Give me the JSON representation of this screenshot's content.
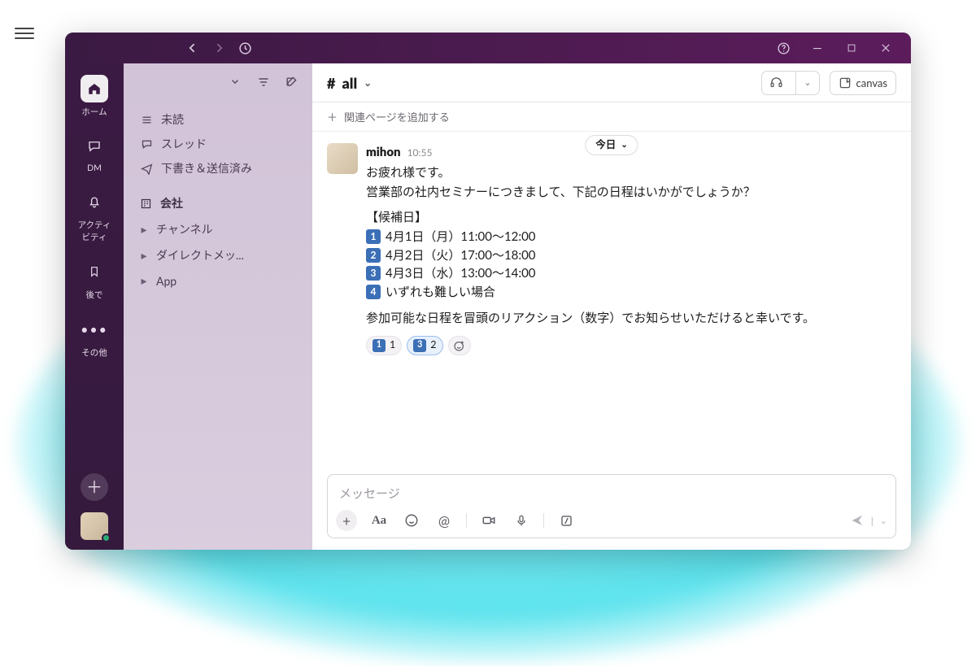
{
  "rail": {
    "home": "ホーム",
    "dm": "DM",
    "activity_l1": "アクティ",
    "activity_l2": "ビティ",
    "later": "後で",
    "more": "その他"
  },
  "sidebar": {
    "unread": "未読",
    "threads": "スレッド",
    "drafts": "下書き＆送信済み",
    "workspace": "会社",
    "channels": "チャンネル",
    "dms": "ダイレクトメッ...",
    "apps": "App"
  },
  "channel": {
    "hash": "#",
    "name": "all",
    "canvas": "canvas",
    "related": "関連ページを追加する",
    "today": "今日"
  },
  "message": {
    "user": "mihon",
    "time": "10:55",
    "line1": "お疲れ様です。",
    "line2": "営業部の社内セミナーにつきまして、下記の日程はいかがでしょうか？",
    "options_title": "【候補日】",
    "opts": [
      {
        "n": "1",
        "text": "4月1日（月）11:00〜12:00"
      },
      {
        "n": "2",
        "text": "4月2日（火）17:00〜18:00"
      },
      {
        "n": "3",
        "text": "4月3日（水）13:00〜14:00"
      },
      {
        "n": "4",
        "text": "いずれも難しい場合"
      }
    ],
    "line3": "参加可能な日程を冒頭のリアクション（数字）でお知らせいただけると幸いです。",
    "reactions": [
      {
        "n": "1",
        "count": "1",
        "selected": false
      },
      {
        "n": "3",
        "count": "2",
        "selected": true
      }
    ]
  },
  "composer": {
    "placeholder": "メッセージ"
  }
}
